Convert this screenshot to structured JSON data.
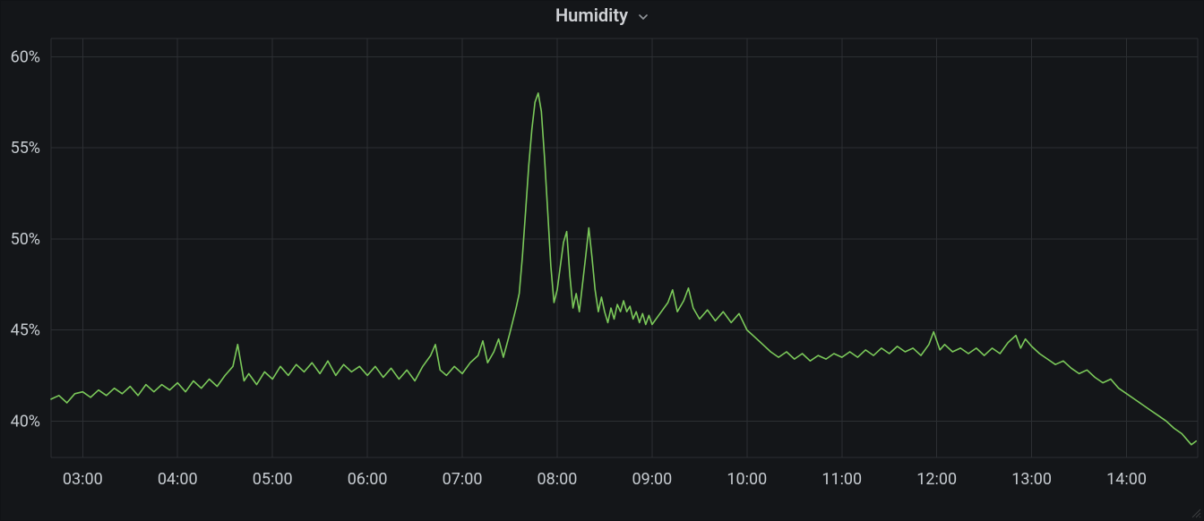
{
  "panel": {
    "title": "Humidity"
  },
  "colors": {
    "series": "#7bc95a",
    "grid": "#2c2f33",
    "bg": "#141619",
    "text": "#c7ccd1"
  },
  "chart_data": {
    "type": "line",
    "title": "Humidity",
    "xlabel": "",
    "ylabel": "",
    "x_unit": "time-hh:mm",
    "y_unit": "percent",
    "y_ticks": [
      40,
      45,
      50,
      55,
      60
    ],
    "y_tick_labels": [
      "40%",
      "45%",
      "50%",
      "55%",
      "60%"
    ],
    "ylim": [
      38,
      61
    ],
    "x_ticks": [
      "03:00",
      "04:00",
      "05:00",
      "06:00",
      "07:00",
      "08:00",
      "09:00",
      "10:00",
      "11:00",
      "12:00",
      "13:00",
      "14:00"
    ],
    "xlim_minutes": [
      160,
      885
    ],
    "series": [
      {
        "name": "Humidity",
        "color": "#7bc95a",
        "data": [
          [
            160,
            41.2
          ],
          [
            165,
            41.4
          ],
          [
            170,
            41.0
          ],
          [
            175,
            41.5
          ],
          [
            180,
            41.6
          ],
          [
            185,
            41.3
          ],
          [
            190,
            41.7
          ],
          [
            195,
            41.4
          ],
          [
            200,
            41.8
          ],
          [
            205,
            41.5
          ],
          [
            210,
            41.9
          ],
          [
            215,
            41.4
          ],
          [
            220,
            42.0
          ],
          [
            225,
            41.6
          ],
          [
            230,
            42.0
          ],
          [
            235,
            41.7
          ],
          [
            240,
            42.1
          ],
          [
            245,
            41.6
          ],
          [
            250,
            42.2
          ],
          [
            255,
            41.8
          ],
          [
            260,
            42.3
          ],
          [
            265,
            41.9
          ],
          [
            270,
            42.5
          ],
          [
            275,
            43.0
          ],
          [
            278,
            44.2
          ],
          [
            282,
            42.2
          ],
          [
            285,
            42.6
          ],
          [
            290,
            42.0
          ],
          [
            295,
            42.7
          ],
          [
            300,
            42.3
          ],
          [
            305,
            43.0
          ],
          [
            310,
            42.5
          ],
          [
            315,
            43.1
          ],
          [
            320,
            42.7
          ],
          [
            325,
            43.2
          ],
          [
            330,
            42.6
          ],
          [
            335,
            43.3
          ],
          [
            340,
            42.5
          ],
          [
            345,
            43.1
          ],
          [
            350,
            42.7
          ],
          [
            355,
            43.0
          ],
          [
            360,
            42.5
          ],
          [
            365,
            43.0
          ],
          [
            370,
            42.4
          ],
          [
            375,
            42.9
          ],
          [
            380,
            42.3
          ],
          [
            385,
            42.8
          ],
          [
            390,
            42.2
          ],
          [
            395,
            43.0
          ],
          [
            400,
            43.6
          ],
          [
            403,
            44.2
          ],
          [
            406,
            42.8
          ],
          [
            410,
            42.5
          ],
          [
            415,
            43.0
          ],
          [
            420,
            42.6
          ],
          [
            425,
            43.2
          ],
          [
            430,
            43.6
          ],
          [
            433,
            44.4
          ],
          [
            436,
            43.2
          ],
          [
            440,
            43.8
          ],
          [
            443,
            44.5
          ],
          [
            446,
            43.5
          ],
          [
            450,
            44.8
          ],
          [
            452,
            45.5
          ],
          [
            454,
            46.2
          ],
          [
            456,
            47.0
          ],
          [
            458,
            49.0
          ],
          [
            460,
            51.5
          ],
          [
            462,
            54.0
          ],
          [
            464,
            56.0
          ],
          [
            466,
            57.5
          ],
          [
            468,
            58.0
          ],
          [
            470,
            57.0
          ],
          [
            472,
            54.5
          ],
          [
            474,
            51.5
          ],
          [
            476,
            48.5
          ],
          [
            478,
            46.5
          ],
          [
            480,
            47.2
          ],
          [
            482,
            48.5
          ],
          [
            484,
            49.8
          ],
          [
            486,
            50.4
          ],
          [
            488,
            48.0
          ],
          [
            490,
            46.2
          ],
          [
            492,
            47.0
          ],
          [
            494,
            46.0
          ],
          [
            496,
            47.5
          ],
          [
            498,
            49.0
          ],
          [
            500,
            50.6
          ],
          [
            502,
            49.0
          ],
          [
            504,
            47.2
          ],
          [
            506,
            46.0
          ],
          [
            508,
            46.8
          ],
          [
            510,
            46.0
          ],
          [
            512,
            45.4
          ],
          [
            514,
            46.2
          ],
          [
            516,
            45.6
          ],
          [
            518,
            46.4
          ],
          [
            520,
            46.0
          ],
          [
            522,
            46.6
          ],
          [
            524,
            46.0
          ],
          [
            526,
            46.3
          ],
          [
            528,
            45.6
          ],
          [
            530,
            46.0
          ],
          [
            532,
            45.4
          ],
          [
            534,
            45.9
          ],
          [
            536,
            45.3
          ],
          [
            538,
            45.8
          ],
          [
            540,
            45.3
          ],
          [
            545,
            45.9
          ],
          [
            550,
            46.5
          ],
          [
            553,
            47.2
          ],
          [
            556,
            46.0
          ],
          [
            560,
            46.6
          ],
          [
            563,
            47.3
          ],
          [
            566,
            46.2
          ],
          [
            570,
            45.6
          ],
          [
            575,
            46.1
          ],
          [
            580,
            45.5
          ],
          [
            585,
            46.0
          ],
          [
            590,
            45.4
          ],
          [
            595,
            45.9
          ],
          [
            600,
            45.0
          ],
          [
            605,
            44.6
          ],
          [
            610,
            44.2
          ],
          [
            615,
            43.8
          ],
          [
            620,
            43.5
          ],
          [
            625,
            43.8
          ],
          [
            630,
            43.4
          ],
          [
            635,
            43.7
          ],
          [
            640,
            43.3
          ],
          [
            645,
            43.6
          ],
          [
            650,
            43.4
          ],
          [
            655,
            43.7
          ],
          [
            660,
            43.5
          ],
          [
            665,
            43.8
          ],
          [
            670,
            43.5
          ],
          [
            675,
            43.9
          ],
          [
            680,
            43.6
          ],
          [
            685,
            44.0
          ],
          [
            690,
            43.7
          ],
          [
            695,
            44.1
          ],
          [
            700,
            43.8
          ],
          [
            705,
            44.0
          ],
          [
            710,
            43.6
          ],
          [
            715,
            44.2
          ],
          [
            718,
            44.9
          ],
          [
            722,
            43.9
          ],
          [
            725,
            44.2
          ],
          [
            730,
            43.8
          ],
          [
            735,
            44.0
          ],
          [
            740,
            43.7
          ],
          [
            745,
            44.0
          ],
          [
            750,
            43.6
          ],
          [
            755,
            44.0
          ],
          [
            760,
            43.7
          ],
          [
            765,
            44.3
          ],
          [
            770,
            44.7
          ],
          [
            773,
            44.0
          ],
          [
            776,
            44.5
          ],
          [
            780,
            44.1
          ],
          [
            785,
            43.7
          ],
          [
            790,
            43.4
          ],
          [
            795,
            43.1
          ],
          [
            800,
            43.3
          ],
          [
            805,
            42.9
          ],
          [
            810,
            42.6
          ],
          [
            815,
            42.8
          ],
          [
            820,
            42.4
          ],
          [
            825,
            42.1
          ],
          [
            830,
            42.3
          ],
          [
            835,
            41.8
          ],
          [
            840,
            41.5
          ],
          [
            845,
            41.2
          ],
          [
            850,
            40.9
          ],
          [
            855,
            40.6
          ],
          [
            860,
            40.3
          ],
          [
            865,
            40.0
          ],
          [
            870,
            39.6
          ],
          [
            875,
            39.3
          ],
          [
            878,
            39.0
          ],
          [
            881,
            38.7
          ],
          [
            884,
            38.9
          ]
        ]
      }
    ]
  }
}
